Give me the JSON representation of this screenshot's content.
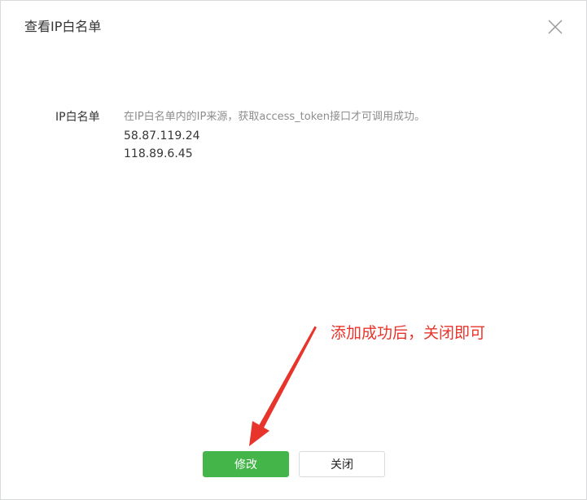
{
  "dialog": {
    "title": "查看IP白名单",
    "close_icon": "close-icon"
  },
  "whitelist": {
    "label": "IP白名单",
    "hint": "在IP白名单内的IP来源，获取access_token接口才可调用成功。",
    "ips": [
      "58.87.119.24",
      "118.89.6.45"
    ]
  },
  "annotation": {
    "text": "添加成功后，关闭即可",
    "color": "#e8352b"
  },
  "buttons": {
    "modify_label": "修改",
    "close_label": "关闭"
  },
  "colors": {
    "primary": "#44b549",
    "border": "#d9dadc",
    "text": "#353535",
    "hint": "#8d8d8d"
  }
}
